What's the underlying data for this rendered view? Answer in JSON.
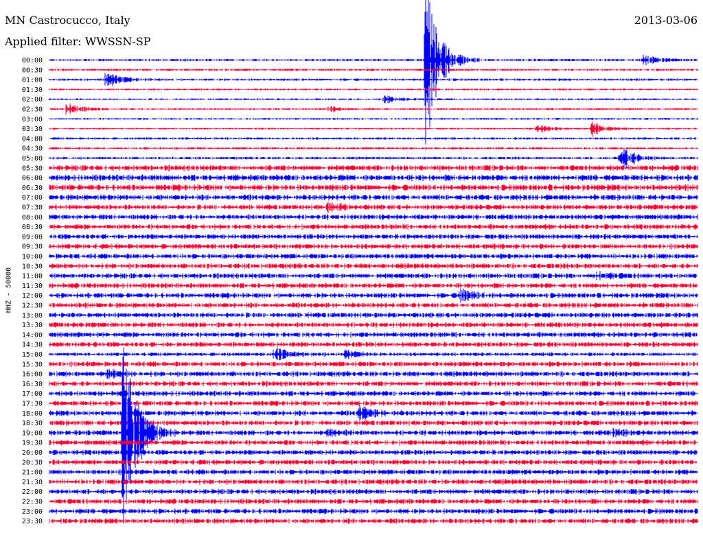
{
  "header": {
    "station": "MN Castrocucco, Italy",
    "date": "2013-03-06",
    "filter": "Applied filter: WWSSN-SP"
  },
  "colors": {
    "blue": "#0000ff",
    "red": "#ff0033"
  },
  "chart_data": {
    "type": "line",
    "title": "MN Castrocucco, Italy",
    "ylabel": "HHZ - 50000",
    "row_labels": [
      "00:00",
      "00:30",
      "01:00",
      "01:30",
      "02:00",
      "02:30",
      "03:00",
      "03:30",
      "04:00",
      "04:30",
      "05:00",
      "05:30",
      "06:00",
      "06:30",
      "07:00",
      "07:30",
      "08:00",
      "08:30",
      "09:00",
      "09:30",
      "10:00",
      "10:30",
      "11:00",
      "11:30",
      "12:00",
      "12:30",
      "13:00",
      "13:30",
      "14:00",
      "14:30",
      "15:00",
      "15:30",
      "16:00",
      "16:30",
      "17:00",
      "17:30",
      "18:00",
      "18:30",
      "19:00",
      "19:30",
      "20:00",
      "20:30",
      "21:00",
      "21:30",
      "22:00",
      "22:30",
      "23:00",
      "23:30"
    ],
    "row_colors": [
      "blue",
      "red"
    ],
    "noise_level": [
      0.15,
      0.15,
      0.15,
      0.05,
      0.05,
      0.05,
      0.05,
      0.03,
      0.15,
      0.15,
      0.2,
      0.8,
      0.9,
      0.9,
      0.8,
      0.7,
      0.7,
      0.7,
      0.7,
      0.7,
      0.7,
      0.7,
      0.7,
      0.7,
      0.7,
      0.7,
      0.7,
      0.7,
      0.7,
      0.7,
      0.4,
      0.7,
      0.7,
      0.7,
      0.7,
      0.7,
      0.7,
      0.7,
      0.7,
      0.7,
      0.7,
      0.7,
      0.7,
      0.7,
      0.7,
      0.7,
      0.7,
      0.7
    ],
    "events": [
      {
        "row": 0,
        "minute": 27.5,
        "amp": 1.4
      },
      {
        "row": 2,
        "minute": 2.6,
        "amp": 2.0
      },
      {
        "row": 4,
        "minute": 15.5,
        "amp": 0.9
      },
      {
        "row": 5,
        "minute": 0.8,
        "amp": 1.8
      },
      {
        "row": 5,
        "minute": 12.9,
        "amp": 0.6
      },
      {
        "row": 0,
        "minute": 17.4,
        "amp": 20.0
      },
      {
        "row": 7,
        "minute": 22.5,
        "amp": 1.2
      },
      {
        "row": 7,
        "minute": 25.1,
        "amp": 1.8
      },
      {
        "row": 10,
        "minute": 26.4,
        "amp": 3.5
      },
      {
        "row": 15,
        "minute": 12.9,
        "amp": 1.0
      },
      {
        "row": 22,
        "minute": 25.3,
        "amp": 1.0
      },
      {
        "row": 24,
        "minute": 19.0,
        "amp": 1.5
      },
      {
        "row": 30,
        "minute": 10.4,
        "amp": 1.8
      },
      {
        "row": 30,
        "minute": 13.7,
        "amp": 0.9
      },
      {
        "row": 32,
        "minute": 2.7,
        "amp": 1.0
      },
      {
        "row": 36,
        "minute": 14.3,
        "amp": 1.8
      },
      {
        "row": 38,
        "minute": 3.4,
        "amp": 25.0
      },
      {
        "row": 38,
        "minute": 12.9,
        "amp": 0.8
      },
      {
        "row": 38,
        "minute": 26.1,
        "amp": 0.8
      }
    ],
    "x_minutes": [
      0,
      30
    ]
  }
}
